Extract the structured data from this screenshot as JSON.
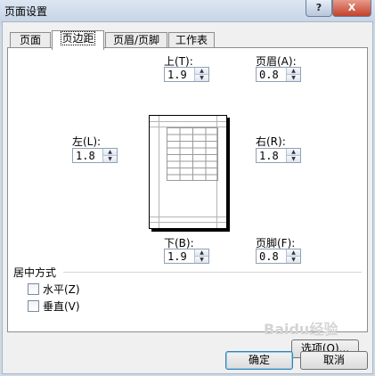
{
  "window": {
    "title": "页面设置",
    "help": "?",
    "close": "X"
  },
  "tabs": [
    "页面",
    "页边距",
    "页眉/页脚",
    "工作表"
  ],
  "margins": {
    "top": {
      "label": "上(T):",
      "value": "1.9"
    },
    "header": {
      "label": "页眉(A):",
      "value": "0.8"
    },
    "left": {
      "label": "左(L):",
      "value": "1.8"
    },
    "right": {
      "label": "右(R):",
      "value": "1.8"
    },
    "bottom": {
      "label": "下(B):",
      "value": "1.9"
    },
    "footer": {
      "label": "页脚(F):",
      "value": "0.8"
    }
  },
  "centering": {
    "title": "居中方式",
    "horizontal": "水平(Z)",
    "vertical": "垂直(V)"
  },
  "buttons": {
    "options": "选项(O)...",
    "ok": "确定",
    "cancel": "取消"
  },
  "watermark": "Baidu经验"
}
